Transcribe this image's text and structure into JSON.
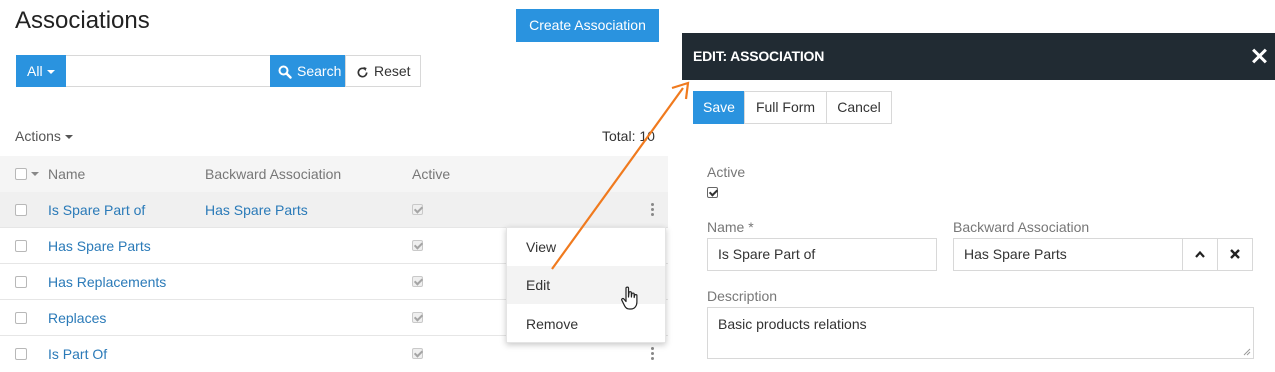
{
  "page": {
    "title": "Associations",
    "create_button": "Create Association"
  },
  "filter": {
    "scope_label": "All",
    "search_value": "",
    "search_button": "Search",
    "reset_button": "Reset"
  },
  "list": {
    "actions_label": "Actions",
    "total_label": "Total: 10",
    "columns": {
      "name": "Name",
      "backward": "Backward Association",
      "active": "Active"
    },
    "rows": [
      {
        "name": "Is Spare Part of",
        "backward": "Has Spare Parts",
        "active": true
      },
      {
        "name": "Has Spare Parts",
        "backward": "",
        "active": true
      },
      {
        "name": "Has Replacements",
        "backward": "",
        "active": true
      },
      {
        "name": "Replaces",
        "backward": "",
        "active": true
      },
      {
        "name": "Is Part Of",
        "backward": "",
        "active": true
      }
    ]
  },
  "row_menu": {
    "items": [
      "View",
      "Edit",
      "Remove"
    ],
    "hovered": "Edit"
  },
  "edit_panel": {
    "title": "EDIT: ASSOCIATION",
    "save_button": "Save",
    "full_form_button": "Full Form",
    "cancel_button": "Cancel",
    "active_label": "Active",
    "active_checked": true,
    "name_label": "Name *",
    "name_value": "Is Spare Part of",
    "backward_label": "Backward Association",
    "backward_value": "Has Spare Parts",
    "description_label": "Description",
    "description_value": "Basic products relations"
  },
  "colors": {
    "primary": "#2a93df",
    "link": "#2a7ab8",
    "panel_header": "#212b33",
    "annotation_arrow": "#f07a1e"
  }
}
